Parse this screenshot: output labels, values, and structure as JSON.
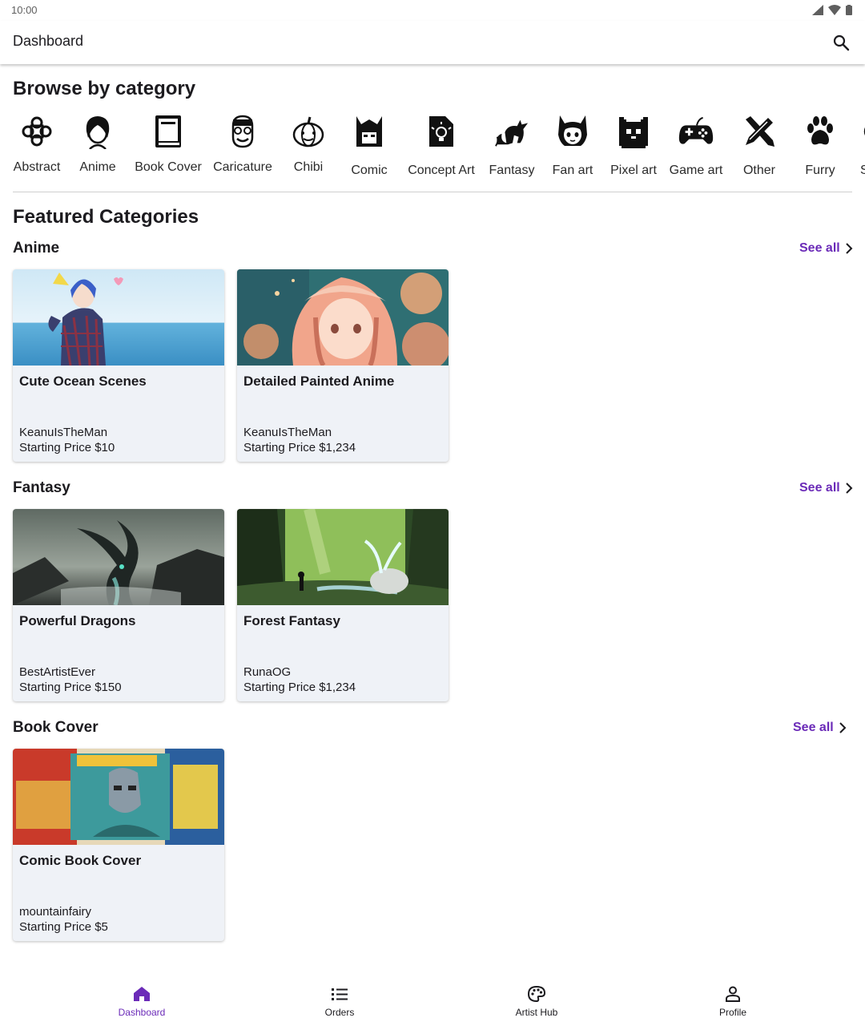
{
  "status": {
    "time": "10:00",
    "icons": [
      "signal-icon",
      "wifi-icon",
      "battery-icon"
    ]
  },
  "appbar": {
    "title": "Dashboard",
    "search_icon": "search-icon"
  },
  "browse": {
    "title": "Browse by category",
    "categories": [
      {
        "label": "Abstract",
        "icon": "abstract-knot-icon"
      },
      {
        "label": "Anime",
        "icon": "anime-face-icon"
      },
      {
        "label": "Book Cover",
        "icon": "book-icon"
      },
      {
        "label": "Caricature",
        "icon": "caricature-face-icon"
      },
      {
        "label": "Chibi",
        "icon": "pumpkin-icon"
      },
      {
        "label": "Comic",
        "icon": "comic-helmet-icon"
      },
      {
        "label": "Concept Art",
        "icon": "idea-document-icon"
      },
      {
        "label": "Fantasy",
        "icon": "dragon-icon"
      },
      {
        "label": "Fan art",
        "icon": "cat-girl-icon"
      },
      {
        "label": "Pixel art",
        "icon": "pixel-cat-icon"
      },
      {
        "label": "Game art",
        "icon": "gamepad-icon"
      },
      {
        "label": "Other",
        "icon": "pencil-cross-icon"
      },
      {
        "label": "Furry",
        "icon": "paw-icon"
      },
      {
        "label": "S",
        "icon": "partial-icon"
      }
    ]
  },
  "featured": {
    "title": "Featured Categories",
    "see_all_label": "See all",
    "groups": [
      {
        "title": "Anime",
        "cards": [
          {
            "title": "Cute Ocean Scenes",
            "artist": "KeanuIsTheMan",
            "price": "Starting Price $10"
          },
          {
            "title": "Detailed Painted Anime",
            "artist": "KeanuIsTheMan",
            "price": "Starting Price $1,234"
          }
        ]
      },
      {
        "title": "Fantasy",
        "cards": [
          {
            "title": "Powerful Dragons",
            "artist": "BestArtistEver",
            "price": "Starting Price $150"
          },
          {
            "title": "Forest Fantasy",
            "artist": "RunaOG",
            "price": "Starting Price $1,234"
          }
        ]
      },
      {
        "title": "Book Cover",
        "cards": [
          {
            "title": "Comic Book Cover",
            "artist": "mountainfairy",
            "price": "Starting Price $5"
          }
        ]
      }
    ]
  },
  "bottom_nav": {
    "items": [
      {
        "label": "Dashboard",
        "icon": "home-icon",
        "active": true
      },
      {
        "label": "Orders",
        "icon": "list-icon",
        "active": false
      },
      {
        "label": "Artist Hub",
        "icon": "palette-icon",
        "active": false
      },
      {
        "label": "Profile",
        "icon": "person-icon",
        "active": false
      }
    ]
  },
  "colors": {
    "accent": "#6b2bb8",
    "card_bg": "#eff2f7",
    "text": "#1c1b1f"
  }
}
